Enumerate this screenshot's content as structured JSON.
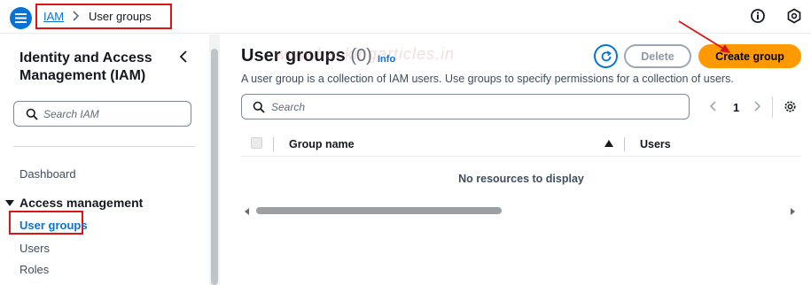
{
  "colors": {
    "accent": "#0972d3",
    "primary_button": "#ff9900",
    "annotation_red": "#d91515"
  },
  "topbar": {
    "menu_icon": "hamburger-menu-icon",
    "breadcrumb": {
      "root": "IAM",
      "current": "User groups"
    },
    "info_icon": "info-circle-icon",
    "settings_icon": "hexagon-settings-icon"
  },
  "sidebar": {
    "title": "Identity and Access Management (IAM)",
    "search_placeholder": "Search IAM",
    "items": {
      "dashboard": "Dashboard",
      "section": "Access management",
      "user_groups": "User groups",
      "users": "Users",
      "roles": "Roles"
    }
  },
  "main": {
    "title": "User groups",
    "count": "(0)",
    "info": "Info",
    "watermark": "www.hackingarticles.in",
    "description": "A user group is a collection of IAM users. Use groups to specify permissions for a collection of users.",
    "buttons": {
      "delete": "Delete",
      "create": "Create group"
    },
    "search_placeholder": "Search",
    "pagination": {
      "page": "1"
    },
    "table": {
      "columns": [
        "Group name",
        "Users"
      ],
      "sort": "ascending",
      "empty_message": "No resources to display"
    }
  }
}
